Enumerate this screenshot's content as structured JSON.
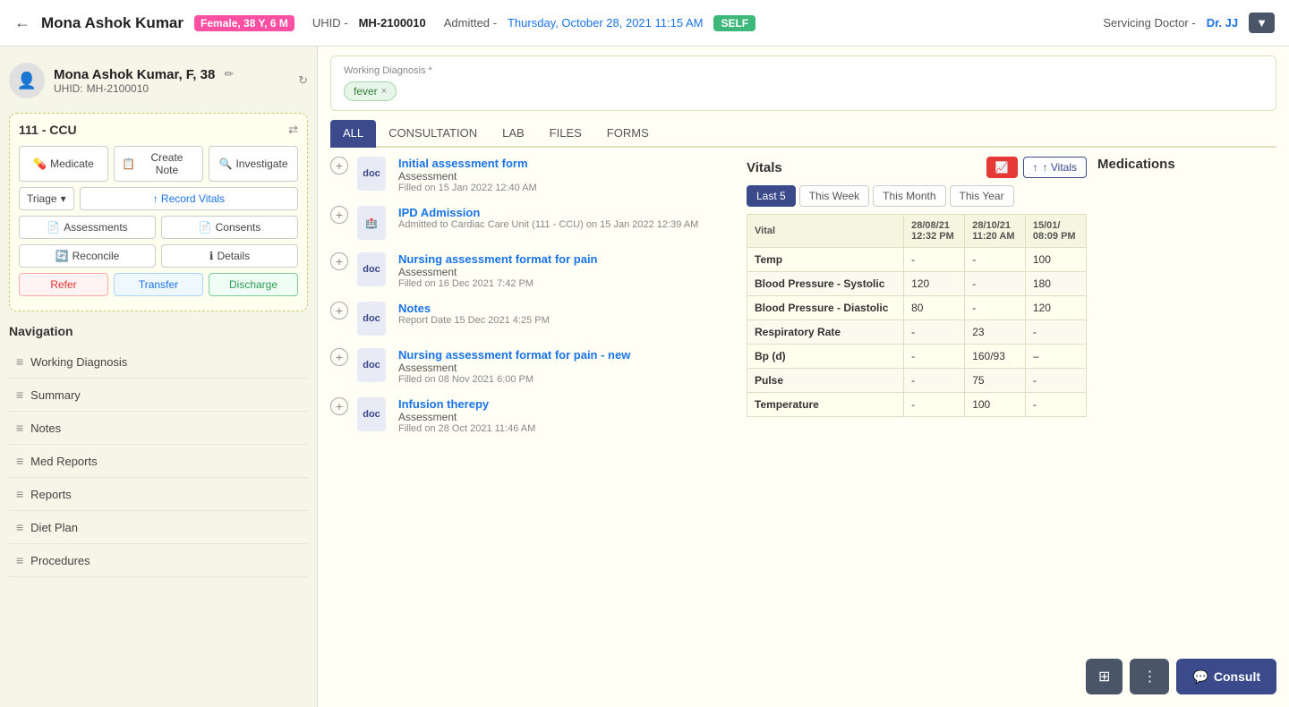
{
  "header": {
    "back_label": "←",
    "patient_name": "Mona Ashok Kumar",
    "gender_badge": "Female, 38 Y, 6 M",
    "uhid_prefix": "UHID -",
    "uhid_value": "MH-2100010",
    "admitted_prefix": "Admitted -",
    "admitted_date": "Thursday, October 28, 2021 11:15 AM",
    "self_badge": "SELF",
    "servicing_label": "Servicing Doctor -",
    "servicing_doctor": "Dr. JJ",
    "dropdown_label": "▼"
  },
  "sidebar": {
    "patient_name": "Mona Ashok Kumar, F, 38",
    "uhid_label": "UHID:",
    "uhid_value": "MH-2100010",
    "ward_title": "111 - CCU",
    "buttons": {
      "medicate": "Medicate",
      "create_note": "Create Note",
      "investigate": "Investigate",
      "triage": "Triage",
      "triage_arrow": "▾",
      "record_vitals": "↑ Record Vitals",
      "assessments": "Assessments",
      "consents": "Consents",
      "reconcile": "Reconcile",
      "details": "Details",
      "refer": "Refer",
      "transfer": "Transfer",
      "discharge": "Discharge"
    },
    "navigation_title": "Navigation",
    "nav_items": [
      {
        "id": "working-diagnosis",
        "label": "Working Diagnosis"
      },
      {
        "id": "summary",
        "label": "Summary"
      },
      {
        "id": "notes",
        "label": "Notes"
      },
      {
        "id": "med-reports",
        "label": "Med Reports"
      },
      {
        "id": "reports",
        "label": "Reports"
      },
      {
        "id": "diet-plan",
        "label": "Diet Plan"
      },
      {
        "id": "procedures",
        "label": "Procedures"
      }
    ]
  },
  "working_diagnosis": {
    "label": "Working Diagnosis *",
    "tag": "fever",
    "remove_icon": "×"
  },
  "tabs": [
    {
      "id": "all",
      "label": "ALL",
      "active": true
    },
    {
      "id": "consultation",
      "label": "CONSULTATION"
    },
    {
      "id": "lab",
      "label": "LAB"
    },
    {
      "id": "files",
      "label": "FILES"
    },
    {
      "id": "forms",
      "label": "FORMS"
    }
  ],
  "assessments": [
    {
      "title": "Initial assessment form",
      "type": "Assessment",
      "date": "Filled on 15 Jan 2022 12:40 AM"
    },
    {
      "title": "IPD Admission",
      "type": null,
      "date": "Admitted to Cardiac Care Unit (111 - CCU) on 15 Jan 2022 12:39 AM"
    },
    {
      "title": "Nursing assessment format for pain",
      "type": "Assessment",
      "date": "Filled on 16 Dec 2021 7:42 PM"
    },
    {
      "title": "Notes",
      "type": null,
      "date": "Report Date 15 Dec 2021 4:25 PM"
    },
    {
      "title": "Nursing assessment format for pain - new",
      "type": "Assessment",
      "date": "Filled on 08 Nov 2021 6:00 PM"
    },
    {
      "title": "Infusion therepy",
      "type": "Assessment",
      "date": "Filled on 28 Oct 2021 11:46 AM"
    }
  ],
  "vitals": {
    "title": "Vitals",
    "chart_btn": "📈",
    "add_btn": "↑ Vitals",
    "filters": [
      "Last 5",
      "This Week",
      "This Month",
      "This Year"
    ],
    "active_filter": "Last 5",
    "columns": [
      "Vital",
      "28/08/21\n12:32 PM",
      "28/10/21\n11:20 AM",
      "15/01/\n08:09 PM"
    ],
    "col_dates": [
      "28/08/21",
      "28/10/21",
      "15/01/"
    ],
    "col_times": [
      "12:32 PM",
      "11:20 AM",
      "08:09 PM"
    ],
    "rows": [
      {
        "label": "Temp",
        "v1": "-",
        "v2": "-",
        "v3": "100"
      },
      {
        "label": "Blood Pressure - Systolic",
        "v1": "120",
        "v2": "-",
        "v3": "180"
      },
      {
        "label": "Blood Pressure - Diastolic",
        "v1": "80",
        "v2": "-",
        "v3": "120"
      },
      {
        "label": "Respiratory Rate",
        "v1": "-",
        "v2": "23",
        "v3": "-"
      },
      {
        "label": "Bp (d)",
        "v1": "-",
        "v2": "160/93",
        "v3": "–"
      },
      {
        "label": "Pulse",
        "v1": "-",
        "v2": "75",
        "v3": "-"
      },
      {
        "label": "Temperature",
        "v1": "-",
        "v2": "100",
        "v3": "-"
      }
    ]
  },
  "medications": {
    "title": "Medications"
  },
  "bottom_toolbar": {
    "grid_icon": "⊞",
    "more_icon": "⋮",
    "consult_icon": "💬",
    "consult_label": "Consult"
  }
}
